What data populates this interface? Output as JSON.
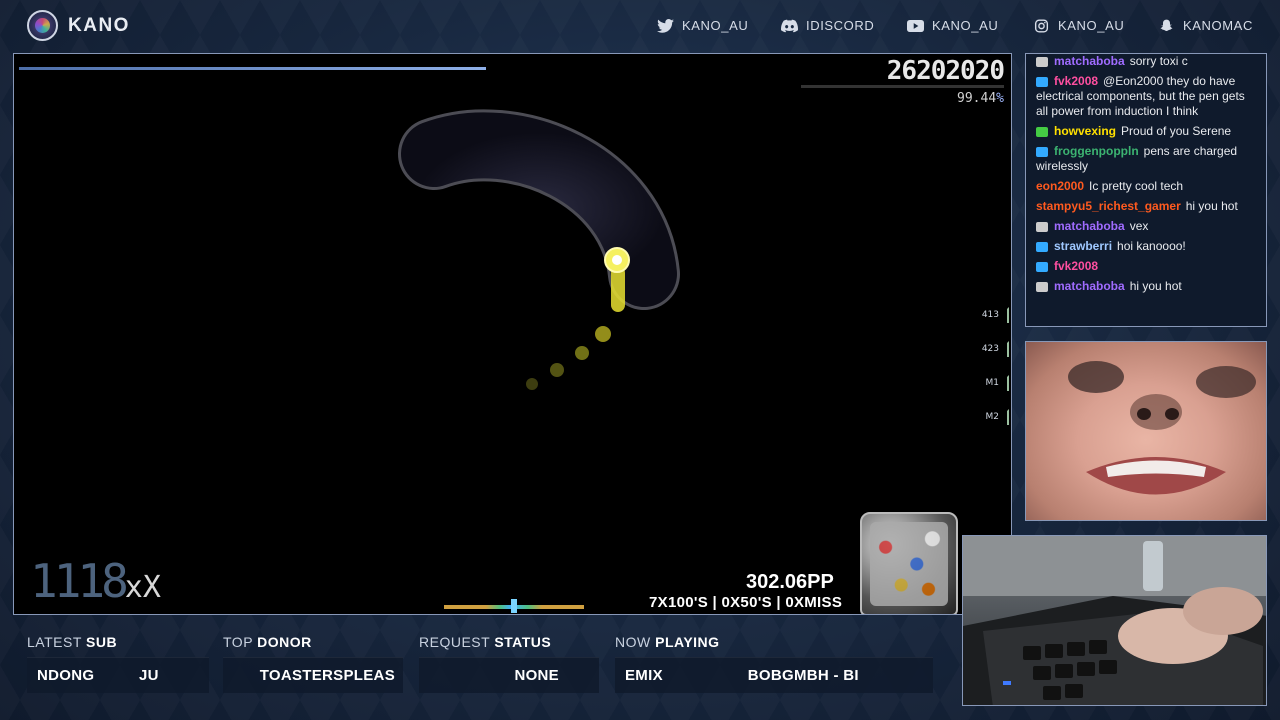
{
  "brand": {
    "name": "KANO"
  },
  "socials": [
    {
      "icon": "twitter-icon",
      "label": "KANO_AU"
    },
    {
      "icon": "discord-icon",
      "label": "IDISCORD"
    },
    {
      "icon": "youtube-icon",
      "label": "KANO_AU"
    },
    {
      "icon": "instagram-icon",
      "label": "KANO_AU"
    },
    {
      "icon": "snapchat-icon",
      "label": "KANOMAC"
    }
  ],
  "game": {
    "score": "26202020",
    "accuracy": "99.44",
    "accuracy_unit": "%",
    "combo_digits": "1118",
    "combo_x": "x",
    "combo_suffix": "X",
    "pp": "302.06PP",
    "judgements": "7X100'S | 0X50'S | 0XMISS",
    "keys": [
      "413",
      "423",
      "M1",
      "M2"
    ]
  },
  "chat": [
    {
      "user": "matchaboba",
      "color": "#a06cff",
      "badge": "#cccccc",
      "msg": "sorry toxi c"
    },
    {
      "user": "fvk2008",
      "color": "#ff4fa0",
      "badge": "#33aaff",
      "msg": "@Eon2000 they do have electrical components, but the pen gets all power from induction I think"
    },
    {
      "user": "howvexing",
      "color": "#ffe000",
      "badge": "#44cc44",
      "msg": "Proud of you Serene"
    },
    {
      "user": "froggenpoppln",
      "color": "#3cb371",
      "badge": "#33aaff",
      "msg": "pens are charged wirelessly"
    },
    {
      "user": "eon2000",
      "color": "#ff5a1f",
      "badge": "",
      "msg": "Ic pretty cool tech"
    },
    {
      "user": "stampyu5_richest_gamer",
      "color": "#ff5a1f",
      "badge": "",
      "msg": "hi you hot"
    },
    {
      "user": "matchaboba",
      "color": "#a06cff",
      "badge": "#cccccc",
      "msg": "vex"
    },
    {
      "user": "strawberri",
      "color": "#9fc8ff",
      "badge": "#33aaff",
      "msg": "hoi kanoooo!"
    },
    {
      "user": "fvk2008",
      "color": "#ff4fa0",
      "badge": "#33aaff",
      "msg": ""
    },
    {
      "user": "matchaboba",
      "color": "#a06cff",
      "badge": "#cccccc",
      "msg": "hi you hot"
    }
  ],
  "info": {
    "latest_sub": {
      "label_a": "LATEST ",
      "label_b": "SUB",
      "value": "NDONG          JU"
    },
    "top_donor": {
      "label_a": "TOP ",
      "label_b": "DONOR",
      "value": "TOASTERSPLEAS"
    },
    "request_status": {
      "label_a": "REQUEST ",
      "label_b": "STATUS",
      "value": "NONE"
    },
    "now_playing": {
      "label_a": "NOW ",
      "label_b": "PLAYING",
      "value": "EMIX                   BOBGMBH - BI"
    }
  }
}
